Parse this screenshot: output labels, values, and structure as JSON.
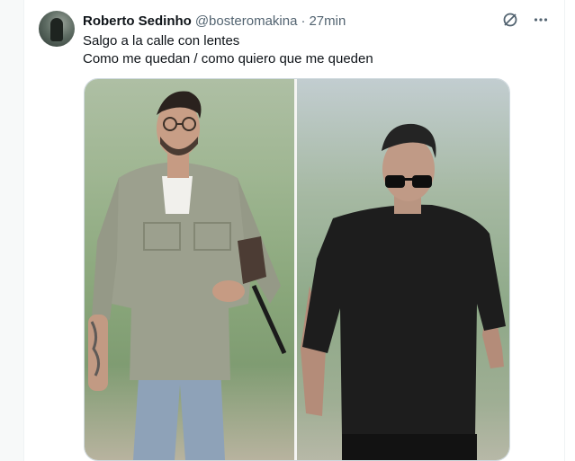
{
  "tweet": {
    "display_name": "Roberto Sedinho",
    "handle": "@bosteromakina",
    "separator": "·",
    "time": "27min",
    "lines": [
      "Salgo a la calle con lentes",
      "Como me quedan / como quiero que me queden"
    ]
  },
  "icons": {
    "grok": "grok-slash-circle-icon",
    "more": "more-horizontal-icon"
  },
  "colors": {
    "text_primary": "#0f1419",
    "text_secondary": "#536471"
  }
}
